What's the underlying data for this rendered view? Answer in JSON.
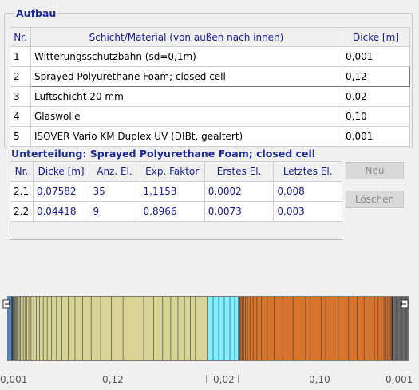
{
  "aufbau": {
    "title": "Aufbau",
    "headers": {
      "nr": "Nr.",
      "material": "Schicht/Material (von außen nach innen)",
      "dicke": "Dicke [m]"
    },
    "rows": [
      {
        "nr": "1",
        "material": "Witterungsschutzbahn (sd=0,1m)",
        "dicke": "0,001"
      },
      {
        "nr": "2",
        "material": "Sprayed Polyurethane Foam; closed cell",
        "dicke": "0,12"
      },
      {
        "nr": "3",
        "material": "Luftschicht 20 mm",
        "dicke": "0,02"
      },
      {
        "nr": "4",
        "material": "Glaswolle",
        "dicke": "0,10"
      },
      {
        "nr": "5",
        "material": "ISOVER Vario KM Duplex UV (DIBt, gealtert)",
        "dicke": "0,001"
      }
    ],
    "selected_row": 2
  },
  "unterteilung": {
    "title": "Unterteilung: Sprayed Polyurethane Foam; closed cell",
    "headers": {
      "nr": "Nr.",
      "dicke": "Dicke [m]",
      "anz": "Anz. El.",
      "exp": "Exp. Faktor",
      "erstes": "Erstes El.",
      "letztes": "Letztes El."
    },
    "rows": [
      {
        "nr": "2.1",
        "dicke": "0,07582",
        "anz": "35",
        "exp": "1,1153",
        "erstes": "0,0002",
        "letztes": "0,008"
      },
      {
        "nr": "2.2",
        "dicke": "0,04418",
        "anz": "9",
        "exp": "0,8966",
        "erstes": "0,0073",
        "letztes": "0,003"
      }
    ]
  },
  "buttons": {
    "neu": "Neu",
    "loeschen": "Löschen"
  },
  "layer_bar": {
    "colors": {
      "membrane": "#4a86c8",
      "foam": "#d8d496",
      "air": "#7ff0ff",
      "glasswool": "#d8742c",
      "vapor": "#8a8a8a",
      "grid_line": "#3a3a3a"
    },
    "labels": [
      "0,001",
      "0,12",
      "0,02",
      "0,10",
      "0,001"
    ]
  }
}
